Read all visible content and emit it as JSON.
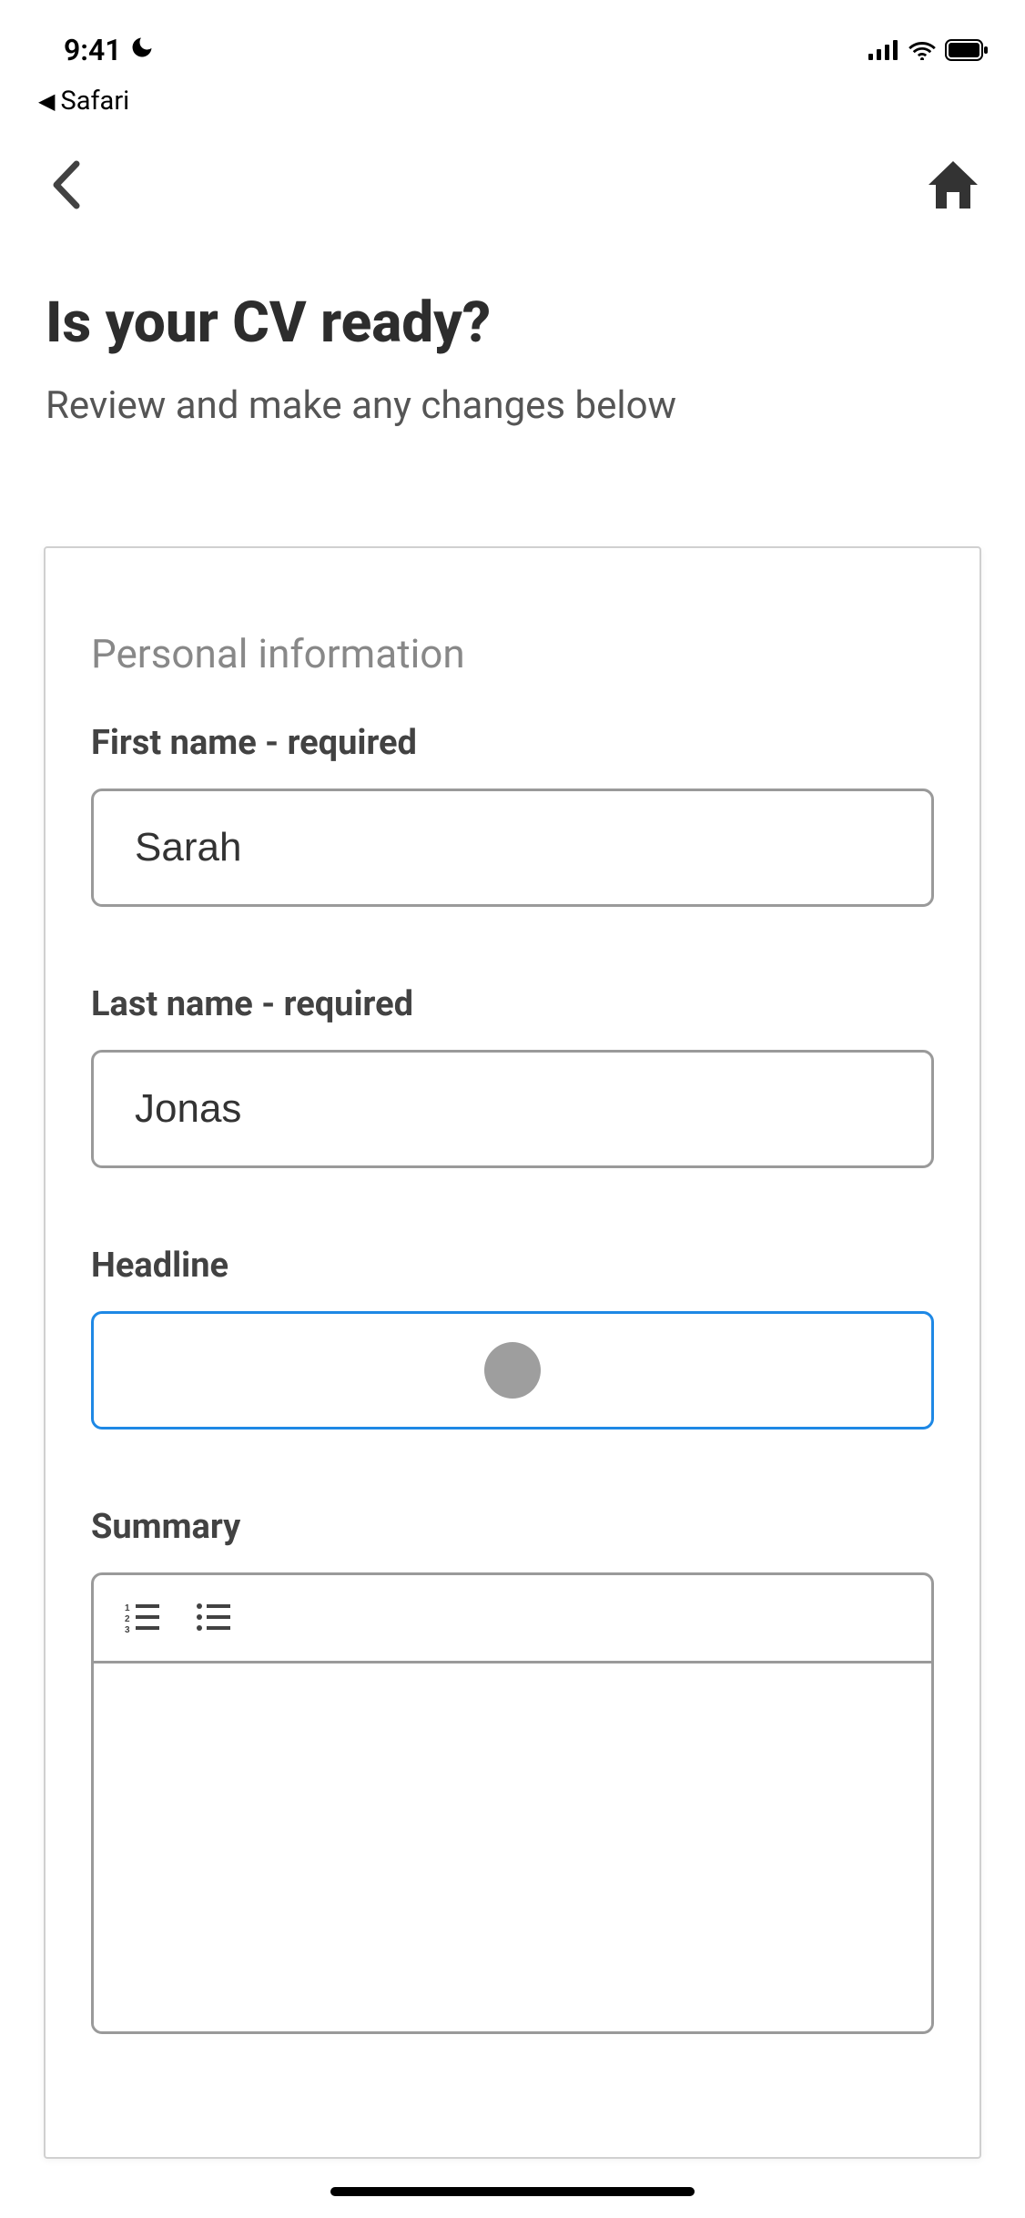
{
  "status_bar": {
    "time": "9:41",
    "back_app": "Safari"
  },
  "header": {
    "title": "Is your CV ready?",
    "subtitle": "Review and make any changes below"
  },
  "form": {
    "section_title": "Personal information",
    "first_name": {
      "label": "First name - required",
      "value": "Sarah"
    },
    "last_name": {
      "label": "Last name - required",
      "value": "Jonas"
    },
    "headline": {
      "label": "Headline",
      "value": ""
    },
    "summary": {
      "label": "Summary",
      "value": ""
    }
  }
}
